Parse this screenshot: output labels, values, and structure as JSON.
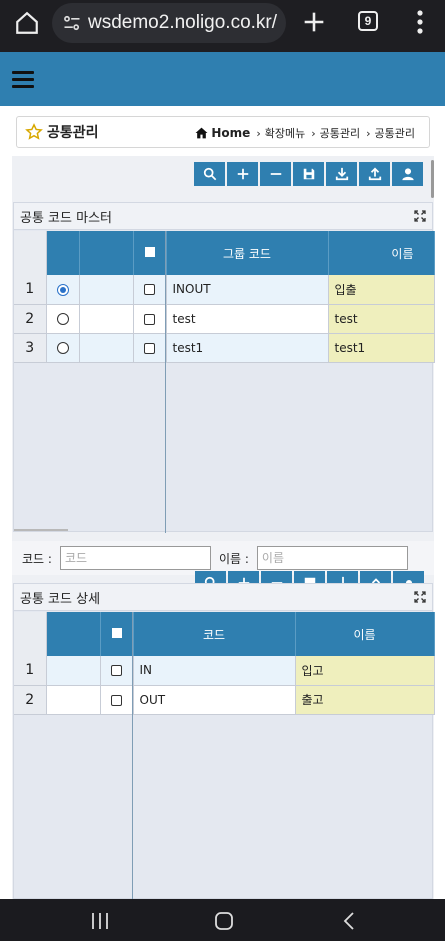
{
  "browser": {
    "url": "wsdemo2.noligo.co.kr/",
    "tab_count": "9"
  },
  "page": {
    "title": "공통관리",
    "breadcrumb": [
      "Home",
      "확장메뉴",
      "공통관리",
      "공통관리"
    ]
  },
  "toolbar_icons": [
    "search-icon",
    "plus-icon",
    "minus-icon",
    "save-icon",
    "download-icon",
    "upload-icon",
    "user-icon"
  ],
  "master": {
    "title": "공통 코드 마스터",
    "columns": [
      "그룹 코드",
      "이름"
    ],
    "rows": [
      {
        "num": "1",
        "selected": true,
        "code": "INOUT",
        "name": "입출"
      },
      {
        "num": "2",
        "selected": false,
        "code": "test",
        "name": "test"
      },
      {
        "num": "3",
        "selected": false,
        "code": "test1",
        "name": "test1"
      }
    ]
  },
  "search": {
    "code_label": "코드 :",
    "code_placeholder": "코드",
    "name_label": "이름 :",
    "name_placeholder": "이름"
  },
  "detail": {
    "title": "공통 코드 상세",
    "columns": [
      "코드",
      "이름"
    ],
    "rows": [
      {
        "num": "1",
        "code": "IN",
        "name": "입고"
      },
      {
        "num": "2",
        "code": "OUT",
        "name": "출고"
      }
    ]
  },
  "colors": {
    "brand": "#2f7fb0",
    "name_cell": "#efefbd",
    "selected_row": "#e9f3fb"
  }
}
